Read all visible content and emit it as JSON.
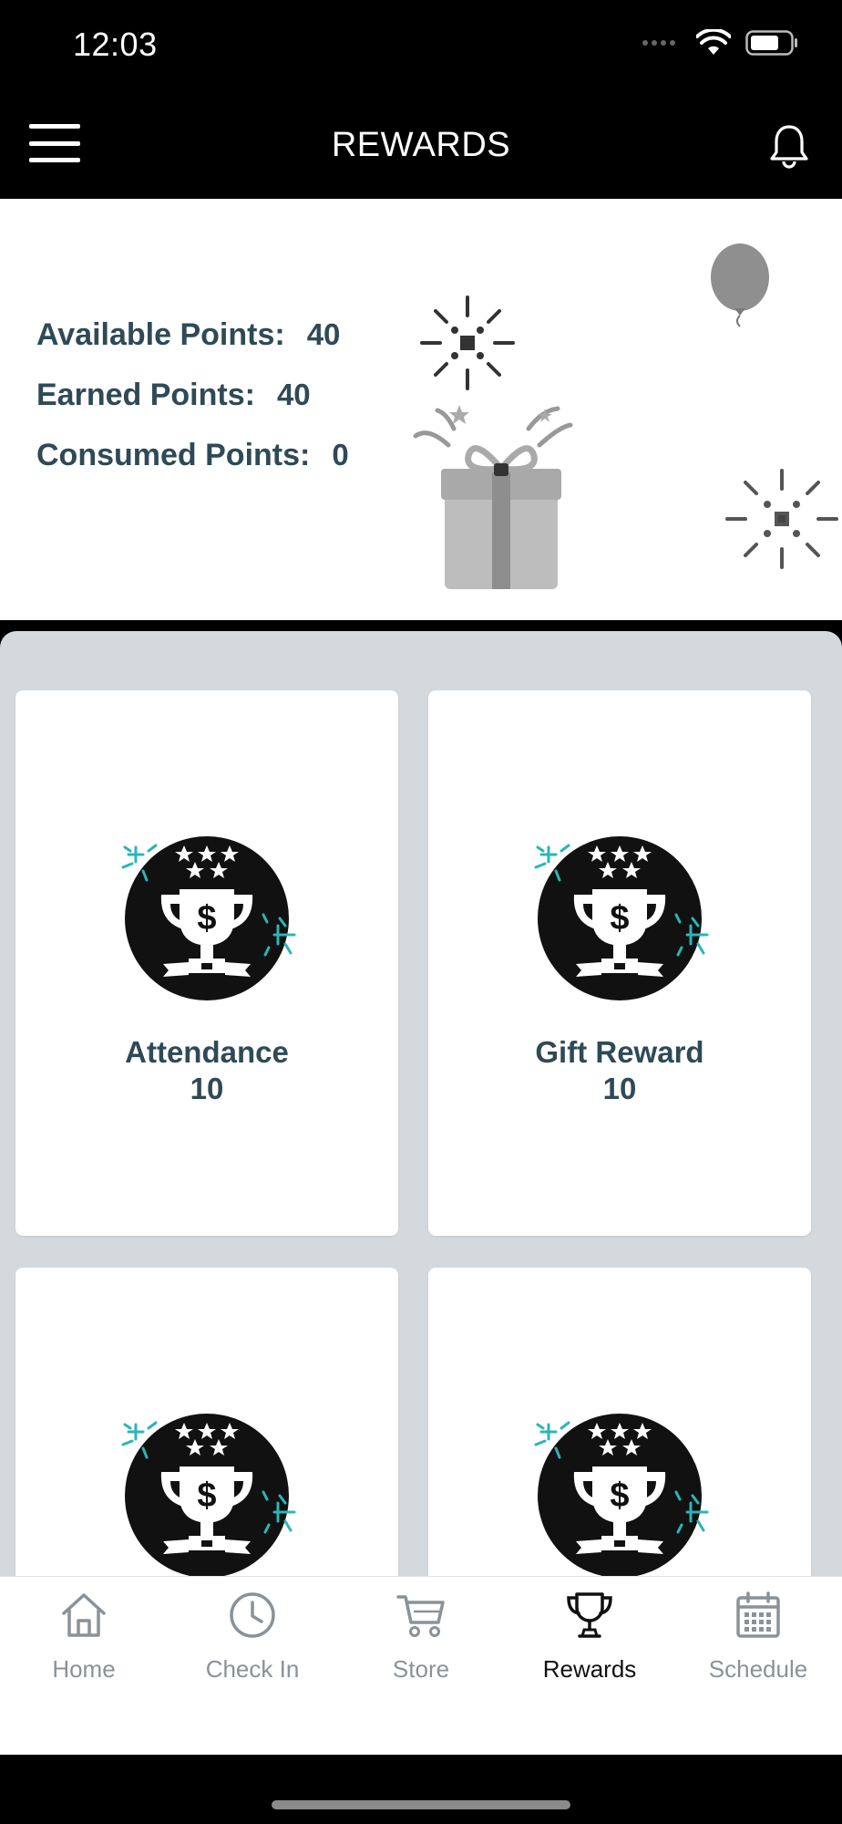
{
  "status_bar": {
    "time": "12:03"
  },
  "header": {
    "title": "REWARDS"
  },
  "points": [
    {
      "label": "Available Points:",
      "value": "40"
    },
    {
      "label": "Earned Points:",
      "value": "40"
    },
    {
      "label": "Consumed Points:",
      "value": "0"
    }
  ],
  "rewards": [
    {
      "name": "Attendance",
      "points": "10"
    },
    {
      "name": "Gift Reward",
      "points": "10"
    },
    {
      "name": "",
      "points": ""
    },
    {
      "name": "",
      "points": ""
    }
  ],
  "tabs": [
    {
      "label": "Home",
      "icon": "home-icon"
    },
    {
      "label": "Check In",
      "icon": "clock-icon"
    },
    {
      "label": "Store",
      "icon": "cart-icon"
    },
    {
      "label": "Rewards",
      "icon": "trophy-icon"
    },
    {
      "label": "Schedule",
      "icon": "calendar-icon"
    }
  ],
  "active_tab": "Rewards",
  "colors": {
    "accent_text": "#2f4a56",
    "grid_background": "#d4d9dd",
    "badge_sparkle": "#2bb5b8"
  }
}
